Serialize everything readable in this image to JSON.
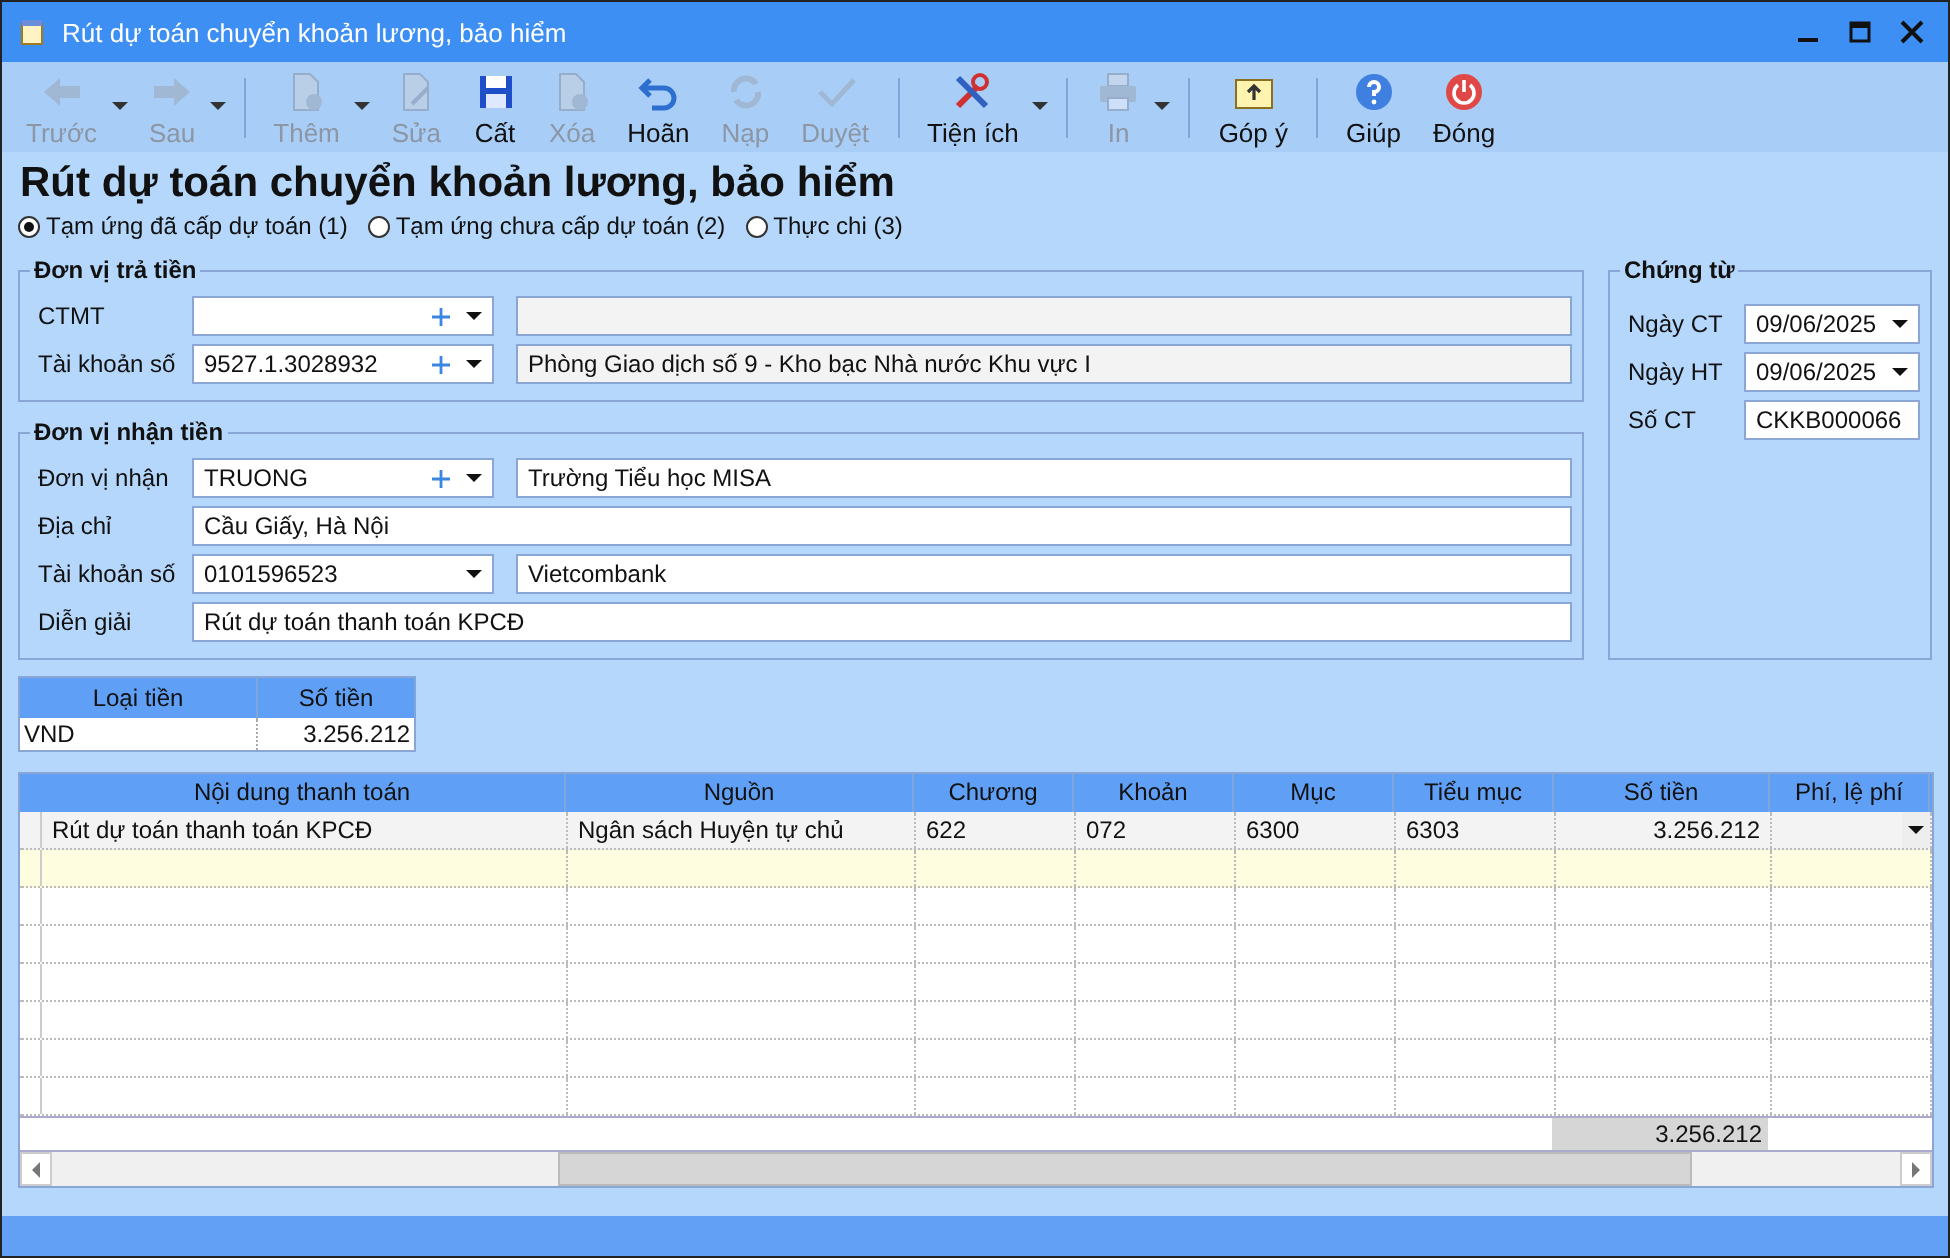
{
  "window": {
    "title": "Rút dự toán chuyển khoản lương, bảo hiểm"
  },
  "toolbar": {
    "groups": [
      [
        {
          "kind": "back",
          "label": "Trước",
          "disabled": true,
          "dropdown": true
        },
        {
          "kind": "forward",
          "label": "Sau",
          "disabled": true,
          "dropdown": true
        }
      ],
      [
        {
          "kind": "add",
          "label": "Thêm",
          "disabled": true,
          "dropdown": true
        },
        {
          "kind": "edit",
          "label": "Sửa",
          "disabled": true,
          "dropdown": false
        },
        {
          "kind": "save",
          "label": "Cất",
          "disabled": false,
          "dropdown": false
        },
        {
          "kind": "delete",
          "label": "Xóa",
          "disabled": true,
          "dropdown": false
        },
        {
          "kind": "undo",
          "label": "Hoãn",
          "disabled": false,
          "dropdown": false
        },
        {
          "kind": "reload",
          "label": "Nạp",
          "disabled": true,
          "dropdown": false
        },
        {
          "kind": "approve",
          "label": "Duyệt",
          "disabled": true,
          "dropdown": false
        }
      ],
      [
        {
          "kind": "tools",
          "label": "Tiện ích",
          "disabled": false,
          "dropdown": true
        }
      ],
      [
        {
          "kind": "print",
          "label": "In",
          "disabled": true,
          "dropdown": true
        }
      ],
      [
        {
          "kind": "feedback",
          "label": "Góp ý",
          "disabled": false,
          "dropdown": false
        }
      ],
      [
        {
          "kind": "help",
          "label": "Giúp",
          "disabled": false,
          "dropdown": false
        },
        {
          "kind": "close",
          "label": "Đóng",
          "disabled": false,
          "dropdown": false
        }
      ]
    ]
  },
  "heading": "Rút dự toán chuyển khoản lương, bảo hiểm",
  "payment_types": [
    {
      "label": "Tạm ứng đã cấp dự toán (1)",
      "selected": true
    },
    {
      "label": "Tạm ứng chưa cấp dự toán (2)",
      "selected": false
    },
    {
      "label": "Thực chi (3)",
      "selected": false
    }
  ],
  "payer": {
    "title": "Đơn vị trả tiền",
    "rows": [
      {
        "kind": "combo",
        "label": "CTMT",
        "add_button": true,
        "name_readonly": true
      },
      {
        "kind": "combo",
        "label": "Tài khoản số",
        "value": "9527.1.3028932",
        "add_button": true,
        "name": "Phòng Giao dịch số 9 - Kho bạc Nhà nước Khu vực I",
        "name_readonly": true
      }
    ]
  },
  "payee": {
    "title": "Đơn vị nhận tiền",
    "rows": [
      {
        "kind": "combo",
        "label": "Đơn vị nhận",
        "value": "TRUONG",
        "add_button": true,
        "name": "Trường Tiểu học MISA",
        "name_readonly": false
      },
      {
        "kind": "text",
        "label": "Địa chỉ",
        "value": "Cầu Giấy, Hà Nội"
      },
      {
        "kind": "combo",
        "label": "Tài khoản số",
        "value": "0101596523",
        "add_button": false,
        "name": "Vietcombank",
        "name_readonly": false
      },
      {
        "kind": "text",
        "label": "Diễn giải",
        "value": "Rút dự toán thanh toán KPCĐ"
      }
    ]
  },
  "voucher": {
    "title": "Chứng từ",
    "rows": [
      {
        "kind": "date",
        "label": "Ngày CT",
        "value": "09/06/2025"
      },
      {
        "kind": "date",
        "label": "Ngày HT",
        "value": "09/06/2025"
      },
      {
        "kind": "text",
        "label": "Số CT",
        "value": "CKKB000066"
      }
    ]
  },
  "currency_table": {
    "columns": [
      "Loại tiền",
      "Số tiền"
    ],
    "rows": [
      [
        "VND",
        "3.256.212"
      ]
    ]
  },
  "grid": {
    "columns": [
      "Nội dung thanh toán",
      "Nguồn",
      "Chương",
      "Khoản",
      "Mục",
      "Tiểu mục",
      "Số tiền",
      "Phí, lệ phí"
    ],
    "rows": [
      {
        "cells": [
          "Rút dự toán thanh toán KPCĐ",
          "Ngân sách Huyện tự chủ",
          "622",
          "072",
          "6300",
          "6303",
          "3.256.212"
        ],
        "fee_dropdown": true
      }
    ],
    "new_row_highlighted": true,
    "total": "3.256.212"
  }
}
